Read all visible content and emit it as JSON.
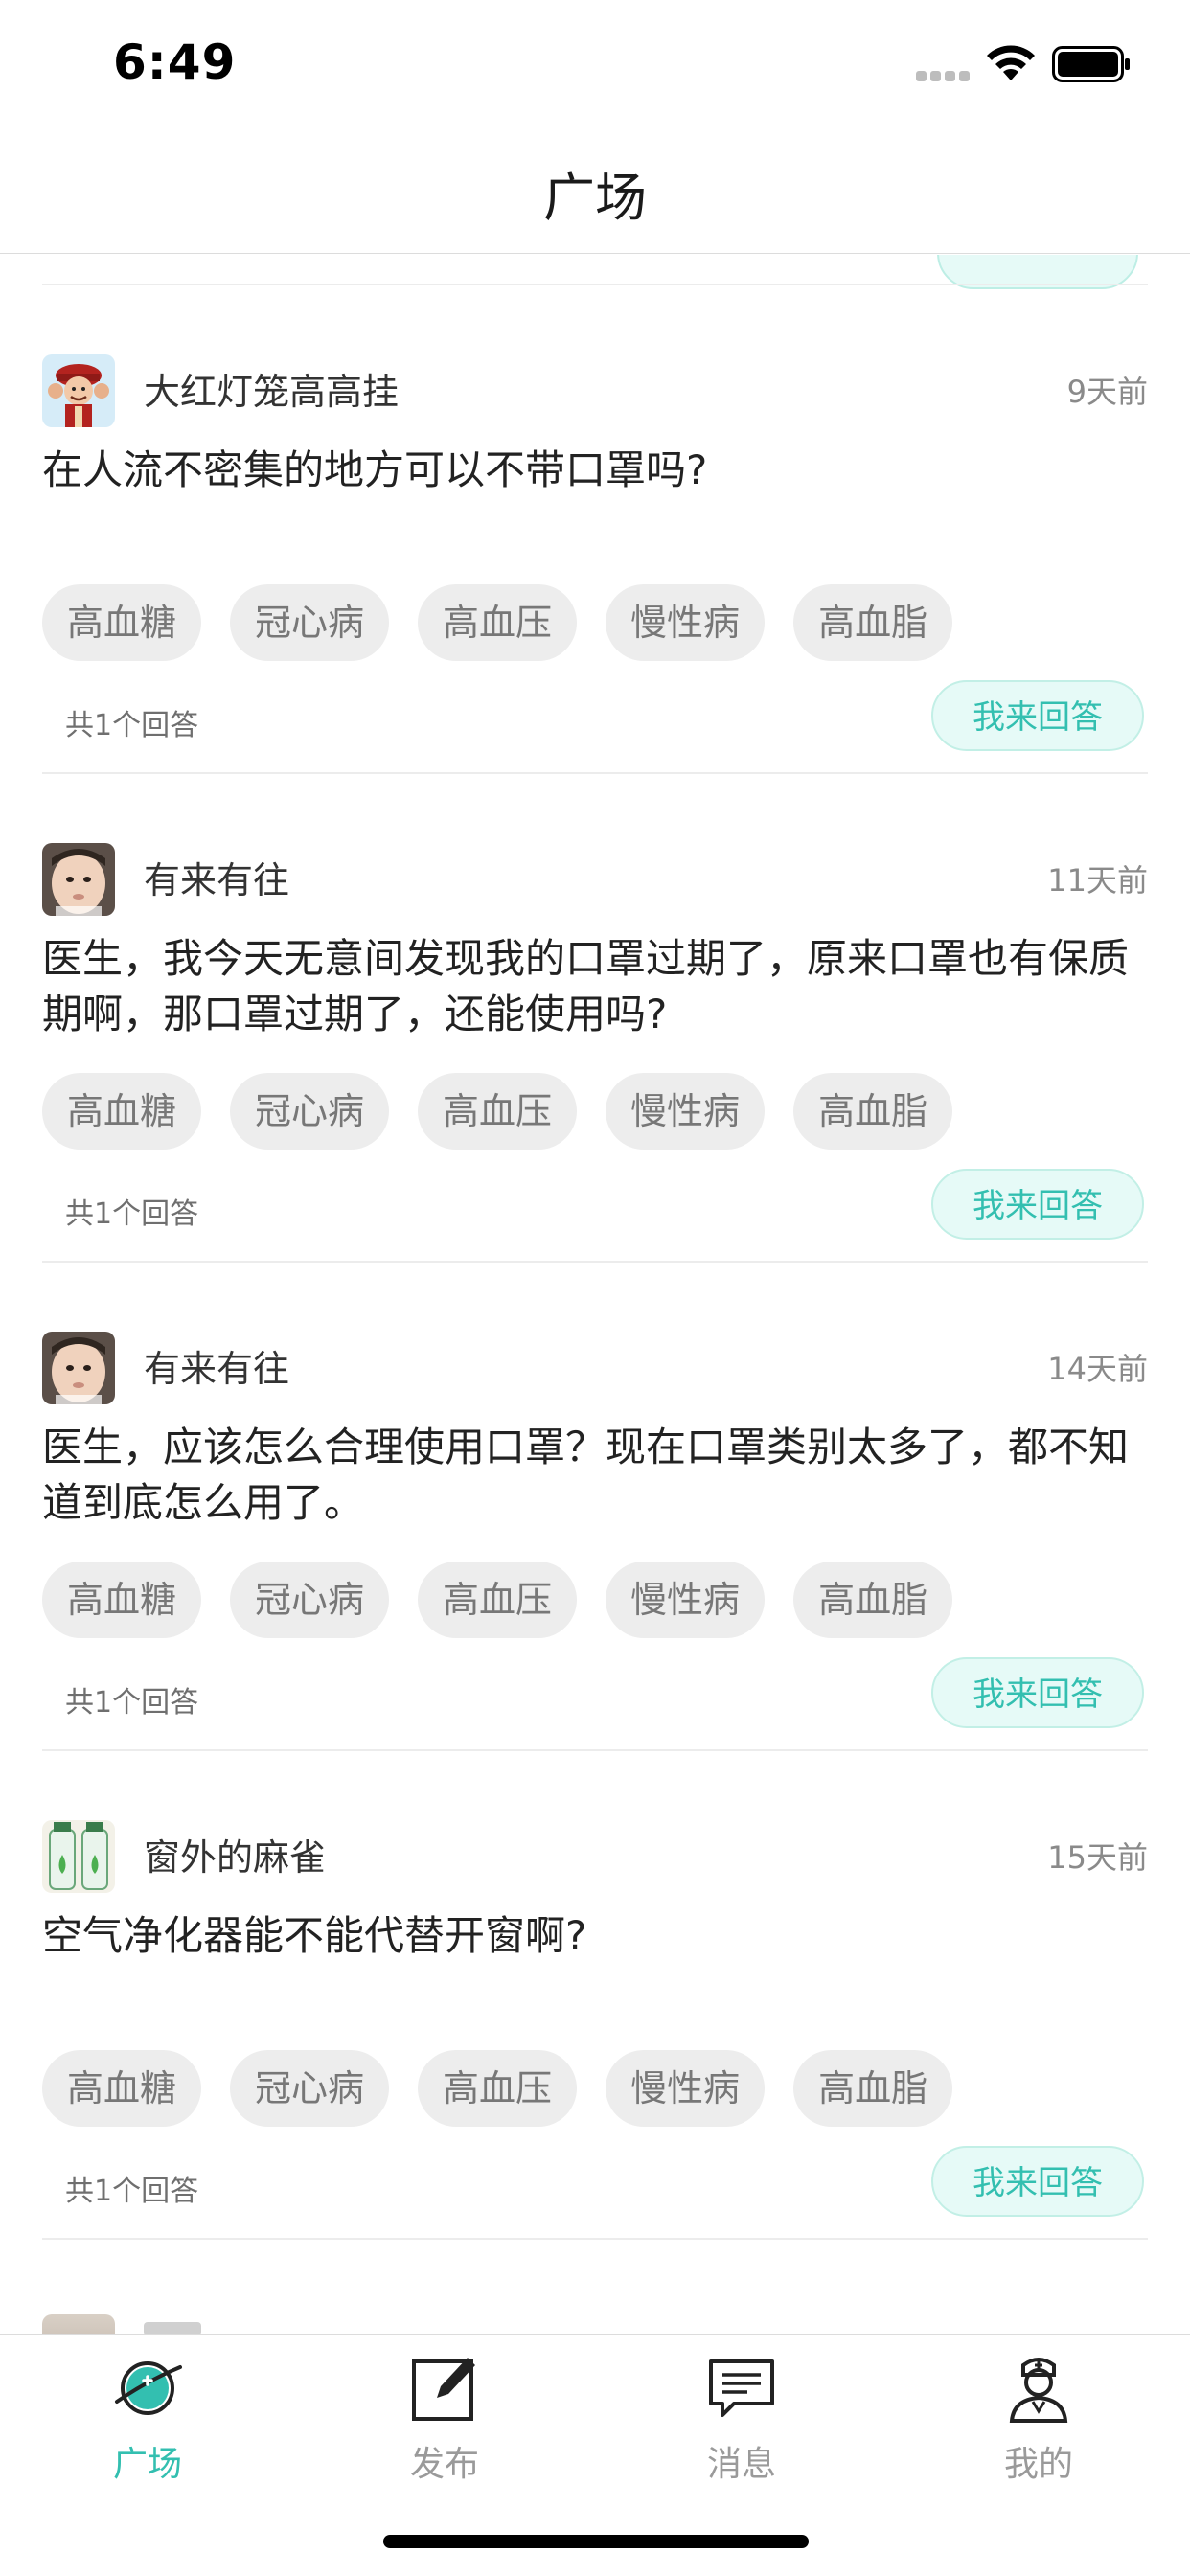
{
  "status_bar": {
    "time": "6:49"
  },
  "nav": {
    "title": "广场"
  },
  "posts": [
    {
      "username": "大红灯笼高高挂",
      "time": "9天前",
      "question": "在人流不密集的地方可以不带口罩吗?",
      "tags": [
        "高血糖",
        "冠心病",
        "高血压",
        "慢性病",
        "高血脂"
      ],
      "answers": "共1个回答",
      "answer_button": "我来回答",
      "avatar_icon": "cartoon-avatar"
    },
    {
      "username": "有来有往",
      "time": "11天前",
      "question": "医生，我今天无意间发现我的口罩过期了，原来口罩也有保质期啊，那口罩过期了，还能使用吗?",
      "tags": [
        "高血糖",
        "冠心病",
        "高血压",
        "慢性病",
        "高血脂"
      ],
      "answers": "共1个回答",
      "answer_button": "我来回答",
      "avatar_icon": "child-photo-avatar"
    },
    {
      "username": "有来有往",
      "time": "14天前",
      "question": "医生，应该怎么合理使用口罩？现在口罩类别太多了，都不知道到底怎么用了。",
      "tags": [
        "高血糖",
        "冠心病",
        "高血压",
        "慢性病",
        "高血脂"
      ],
      "answers": "共1个回答",
      "answer_button": "我来回答",
      "avatar_icon": "child-photo-avatar"
    },
    {
      "username": "窗外的麻雀",
      "time": "15天前",
      "question": "空气净化器能不能代替开窗啊?",
      "tags": [
        "高血糖",
        "冠心病",
        "高血压",
        "慢性病",
        "高血脂"
      ],
      "answers": "共1个回答",
      "answer_button": "我来回答",
      "avatar_icon": "bottles-photo-avatar"
    }
  ],
  "tabs": [
    {
      "label": "广场",
      "icon": "planet-plaza-icon",
      "active": true
    },
    {
      "label": "发布",
      "icon": "compose-icon",
      "active": false
    },
    {
      "label": "消息",
      "icon": "message-icon",
      "active": false
    },
    {
      "label": "我的",
      "icon": "doctor-profile-icon",
      "active": false
    }
  ],
  "colors": {
    "accent": "#33bfb0",
    "tag_bg": "#ededed",
    "answer_btn_bg": "#e6faf7"
  }
}
